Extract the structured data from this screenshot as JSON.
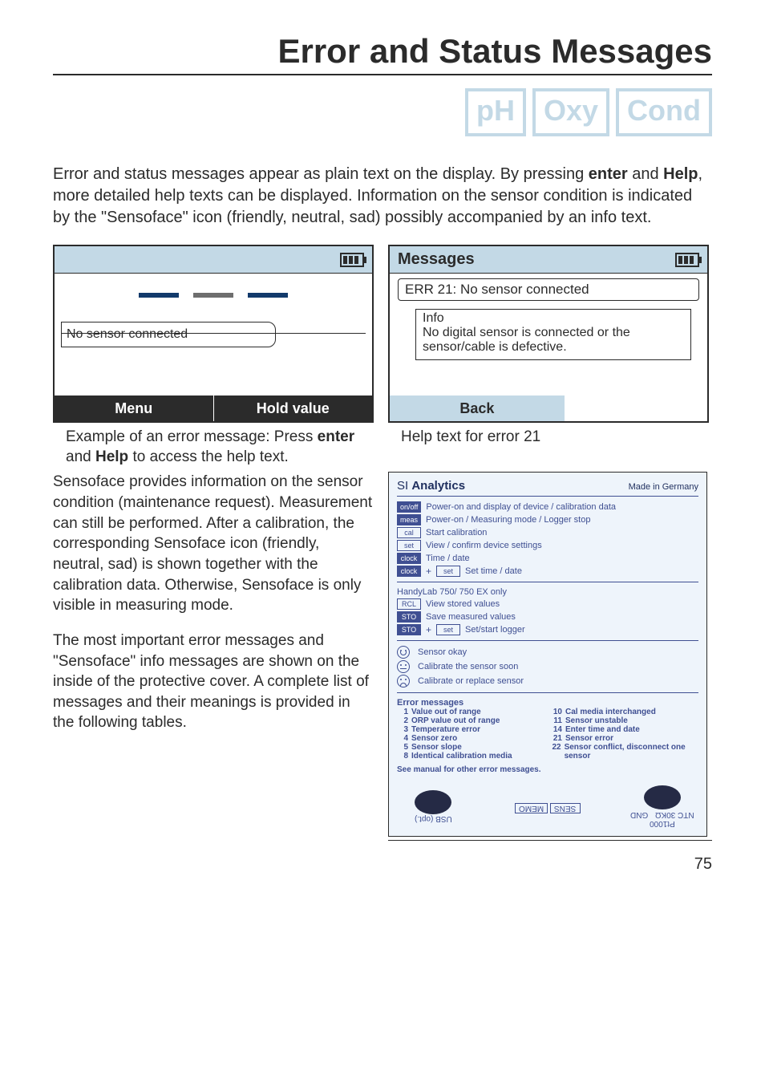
{
  "page": {
    "title": "Error and Status Messages",
    "number": "75"
  },
  "badges": [
    "pH",
    "Oxy",
    "Cond"
  ],
  "intro": {
    "pre": "Error and status messages appear as plain text on the display. By pressing ",
    "b1": "enter",
    "mid1": " and ",
    "b2": "Help",
    "post": ", more detailed help texts can be displayed. Information on the sensor condition is indicated by the \"Sensoface\" icon (friendly, neutral, sad) possibly accompanied by an info text."
  },
  "display_left": {
    "status": "No sensor connected",
    "softkeys": [
      "Menu",
      "Hold value"
    ]
  },
  "display_right": {
    "title": "Messages",
    "line": "ERR 21: No sensor connected",
    "info_head": "Info",
    "info_body": "No digital sensor is connected or the sensor/cable is defective.",
    "softkey": "Back"
  },
  "captions": {
    "left_pre": "Example of an error message: Press ",
    "left_b1": "enter",
    "left_mid": " and ",
    "left_b2": "Help",
    "left_post": " to access the help text.",
    "right": "Help text for error 21"
  },
  "body": {
    "para1": "Sensoface provides information on the sensor condition (maintenance request). Measurement can still be performed. After a calibration, the corresponding Sensoface icon (friendly, neutral, sad) is shown together with the calibration data. Otherwise, Sensoface is only visible in measuring mode.",
    "para2": "The most important error messages and \"Sensoface\" info messages are shown on the inside of the protective cover. A complete list of messages and their meanings is provided in the following tables."
  },
  "panel": {
    "brand1": "SI ",
    "brand2": "Analytics",
    "made": "Made in Germany",
    "keys": [
      {
        "cap": "on/off",
        "fill": true,
        "text": "Power-on and display of device / calibration data"
      },
      {
        "cap": "meas",
        "fill": true,
        "text": "Power-on / Measuring mode / Logger stop"
      },
      {
        "cap": "cal",
        "fill": false,
        "text": "Start calibration"
      },
      {
        "cap": "set",
        "fill": false,
        "text": "View / confirm device settings"
      },
      {
        "cap": "clock",
        "fill": true,
        "text": "Time / date"
      }
    ],
    "combo1": {
      "caps": [
        "clock",
        "set"
      ],
      "text": "Set time / date"
    },
    "section2_head": "HandyLab 750/ 750 EX only",
    "keys2": [
      {
        "cap": "RCL",
        "fill": false,
        "text": "View stored values"
      },
      {
        "cap": "STO",
        "fill": true,
        "text": "Save measured values"
      }
    ],
    "combo2": {
      "caps": [
        "STO",
        "set"
      ],
      "text": "Set/start logger"
    },
    "faces": [
      "Sensor okay",
      "Calibrate the sensor soon",
      "Calibrate or replace sensor"
    ],
    "errhead": "Error messages",
    "errs_left": [
      {
        "n": "1",
        "t": "Value out of range"
      },
      {
        "n": "2",
        "t": "ORP value out of range"
      },
      {
        "n": "3",
        "t": "Temperature error"
      },
      {
        "n": "4",
        "t": "Sensor zero"
      },
      {
        "n": "5",
        "t": "Sensor slope"
      },
      {
        "n": "8",
        "t": "Identical calibration media"
      }
    ],
    "errs_right": [
      {
        "n": "10",
        "t": "Cal media interchanged"
      },
      {
        "n": "11",
        "t": "Sensor unstable"
      },
      {
        "n": "14",
        "t": "Enter time and date"
      },
      {
        "n": "21",
        "t": "Sensor error"
      },
      {
        "n": "22",
        "t": "Sensor conflict, disconnect one sensor"
      }
    ],
    "see": "See manual for other error messages.",
    "ports": {
      "left": "USB (opt.)",
      "mid1": "MEMO",
      "mid2": "SENS",
      "right_top": "NTC 30KΩ",
      "right_bot": "Pt1000",
      "gnd": "GND"
    }
  }
}
